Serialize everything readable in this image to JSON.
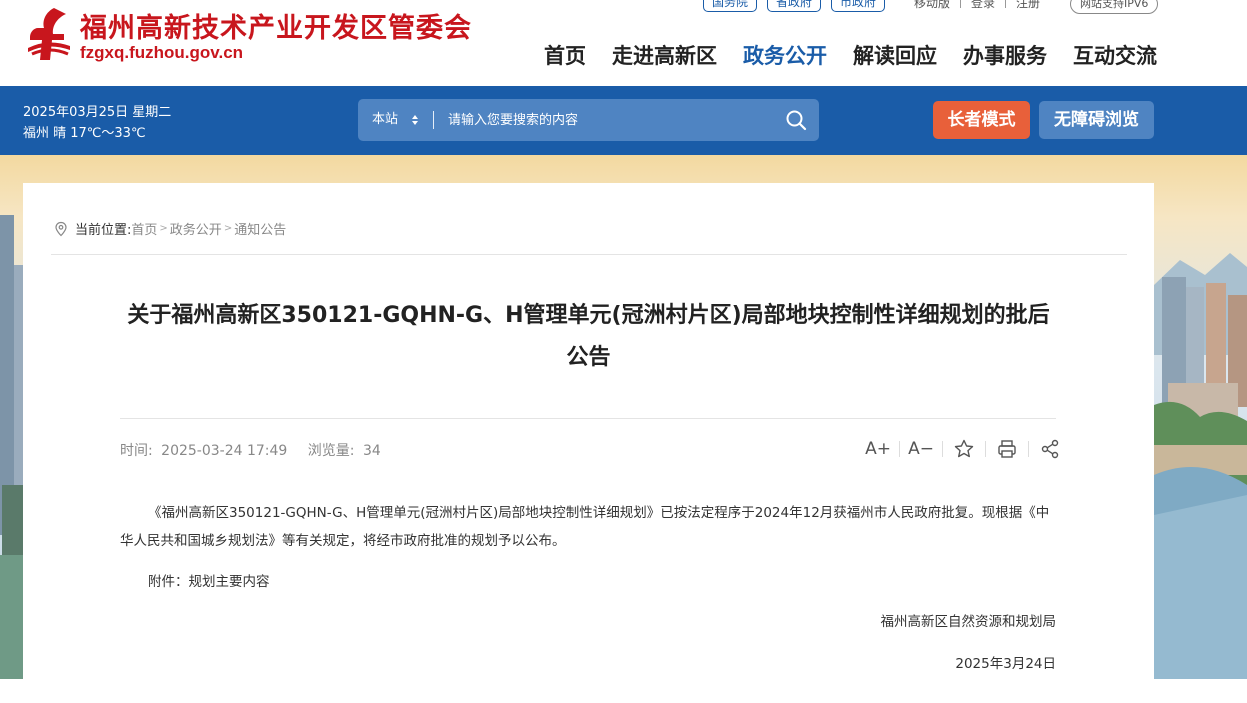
{
  "header": {
    "site_name": "福州高新技术产业开发区管委会",
    "site_domain": "fzgxq.fuzhou.gov.cn",
    "gov_links": [
      "国务院",
      "省政府",
      "市政府"
    ],
    "util_links": [
      "移动版",
      "登录",
      "注册"
    ],
    "ipv6_badge": "网站支持IPV6",
    "nav": [
      "首页",
      "走进高新区",
      "政务公开",
      "解读回应",
      "办事服务",
      "互动交流"
    ],
    "active_nav": "政务公开",
    "brand_color": "#c8161d",
    "accent_color": "#1a5ca8"
  },
  "topbar": {
    "date": "2025年03月25日 星期二",
    "weather": "福州 晴 17℃～33℃",
    "search_scope": "本站",
    "search_placeholder": "请输入您要搜索的内容",
    "elder_mode": "长者模式",
    "accessible": "无障碍浏览",
    "elder_color": "#e8603a"
  },
  "breadcrumb": {
    "label": "当前位置:",
    "items": [
      "首页",
      "政务公开",
      "通知公告"
    ],
    "icon": "location-pin-icon"
  },
  "article": {
    "title": "关于福州高新区350121-GQHN-G、H管理单元(冠洲村片区)局部地块控制性详细规划的批后公告",
    "time_label": "时间:",
    "time_value": "2025-03-24 17:49",
    "views_label": "浏览量:",
    "views_value": "34",
    "paragraph": "《福州高新区350121-GQHN-G、H管理单元(冠洲村片区)局部地块控制性详细规划》已按法定程序于2024年12月获福州市人民政府批复。现根据《中华人民共和国城乡规划法》等有关规定，将经市政府批准的规划予以公布。",
    "attachment": "附件：规划主要内容",
    "signature_org": "福州高新区自然资源和规划局",
    "signature_date": "2025年3月24日",
    "tools": {
      "font_larger": "A+",
      "font_smaller": "A−"
    }
  }
}
